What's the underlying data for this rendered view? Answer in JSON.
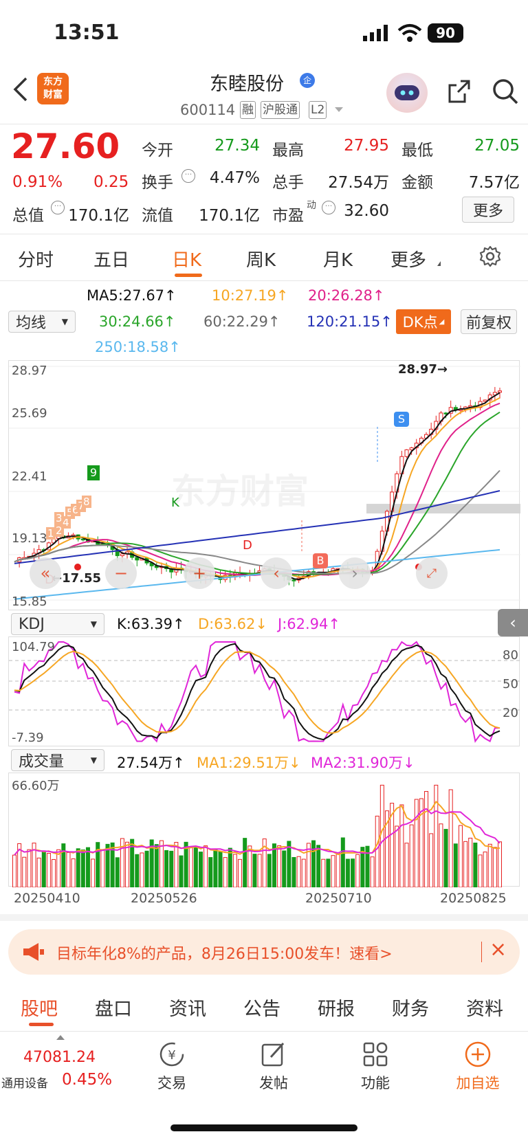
{
  "status": {
    "time": "13:51",
    "battery": "90"
  },
  "header": {
    "logo_line1": "东方",
    "logo_line2": "财富",
    "name": "东睦股份",
    "badge": "企",
    "code": "600114",
    "tags": [
      "融",
      "沪股通",
      "L2"
    ]
  },
  "quote": {
    "price": "27.60",
    "pct": "0.91%",
    "chg": "0.25",
    "cells": [
      {
        "label": "今开",
        "value": "27.34",
        "color": "#159a1c"
      },
      {
        "label": "最高",
        "value": "27.95",
        "color": "#e62020"
      },
      {
        "label": "最低",
        "value": "27.05",
        "color": "#159a1c"
      },
      {
        "label": "换手",
        "value": "4.47%",
        "color": "#222"
      },
      {
        "label": "总手",
        "value": "27.54万",
        "color": "#222"
      },
      {
        "label": "金额",
        "value": "7.57亿",
        "color": "#222"
      },
      {
        "label": "总值",
        "value": "170.1亿",
        "color": "#222"
      },
      {
        "label": "流值",
        "value": "170.1亿",
        "color": "#222"
      },
      {
        "label": "市盈",
        "sup": "动",
        "value": "32.60",
        "color": "#222"
      }
    ],
    "more": "更多"
  },
  "tabs": [
    "分时",
    "五日",
    "日K",
    "周K",
    "月K",
    "更多"
  ],
  "active_tab": "日K",
  "ma": {
    "select": "均线",
    "ma5": "MA5:27.67↑",
    "ma10": "10:27.19↑",
    "ma20": "20:26.28↑",
    "ma30": "30:24.66↑",
    "ma60": "60:22.29↑",
    "ma120": "120:21.15↑",
    "ma250": "250:18.58↑",
    "dk": "DK点",
    "fq": "前复权"
  },
  "kline": {
    "y_labels": [
      "28.97",
      "25.69",
      "22.41",
      "19.13",
      "15.85"
    ],
    "high_mark": "28.97→",
    "low_mark": "17.55",
    "sig_s": "S",
    "sig_b": "B",
    "sig_d1": "D",
    "sig_d2": "D",
    "sig_k": "K",
    "sig_9": "9",
    "watermark": "东方财富",
    "seq_nums": [
      "1",
      "2",
      "3",
      "4",
      "5",
      "6",
      "7",
      "8"
    ]
  },
  "kdj": {
    "select": "KDJ",
    "k": "K:63.39↑",
    "d": "D:63.62↓",
    "j": "J:62.94↑",
    "top": "104.79",
    "bottom": "-7.39",
    "r80": "80",
    "r50": "50",
    "r20": "20"
  },
  "vol": {
    "select": "成交量",
    "v": "27.54万↑",
    "ma1": "MA1:29.51万↓",
    "ma2": "MA2:31.90万↓",
    "top": "66.60万",
    "dates": [
      "20250410",
      "20250526",
      "20250710",
      "20250825"
    ]
  },
  "ad": {
    "text": "目标年化8%的产品，8月26日15:00发车！速看>"
  },
  "bottom_tabs": [
    "股吧",
    "盘口",
    "资讯",
    "公告",
    "研报",
    "财务",
    "资料"
  ],
  "nav": {
    "index_value": "47081.24",
    "index_name": "通用设备",
    "index_pct": "0.45%",
    "items": [
      "交易",
      "发帖",
      "功能",
      "加自选"
    ]
  },
  "colors": {
    "up": "#e62020",
    "down": "#159a1c",
    "accent": "#f06a1b",
    "ma5": "#111111",
    "ma10": "#f6a623",
    "ma20": "#e0218a",
    "ma30": "#2aa52a",
    "ma60": "#888888",
    "ma120": "#2431b5",
    "ma250": "#5ab8ee"
  }
}
